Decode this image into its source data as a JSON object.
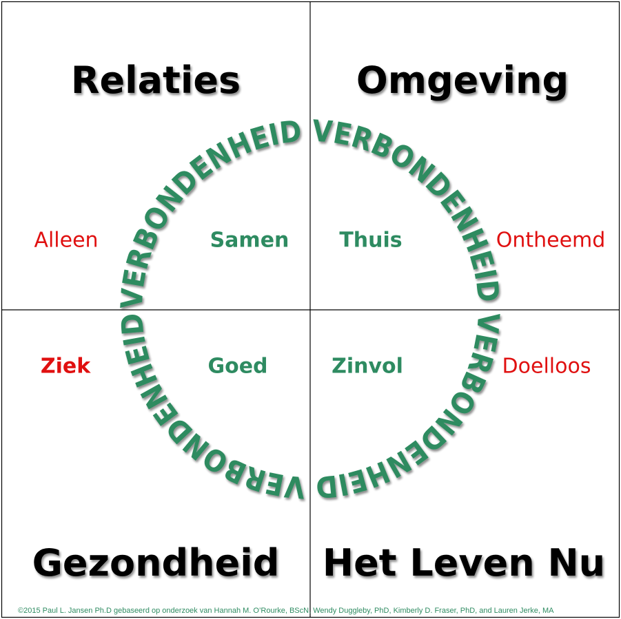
{
  "quadrants": {
    "top_left": {
      "title": "Relaties",
      "negative": "Alleen",
      "positive": "Samen"
    },
    "top_right": {
      "title": "Omgeving",
      "negative": "Ontheemd",
      "positive": "Thuis"
    },
    "bottom_left": {
      "title": "Gezondheid",
      "negative": "Ziek",
      "positive": "Goed"
    },
    "bottom_right": {
      "title": "Het Leven Nu",
      "negative": "Doelloos",
      "positive": "Zinvol"
    }
  },
  "ring": {
    "text": "VERBONDENHEID VERBONDENHEID VERBONDENHEID VERBONDENHEID"
  },
  "copyright": "©2015 Paul L. Jansen Ph.D  gebaseerd op onderzoek van Hannah M. O’Rourke, BScN, Wendy Duggleby, PhD, Kimberly D. Fraser, PhD, and Lauren Jerke, MA",
  "colors": {
    "positive": "#2e8b61",
    "negative": "#e01010",
    "ring": "#2e8b61",
    "border": "#000000"
  }
}
